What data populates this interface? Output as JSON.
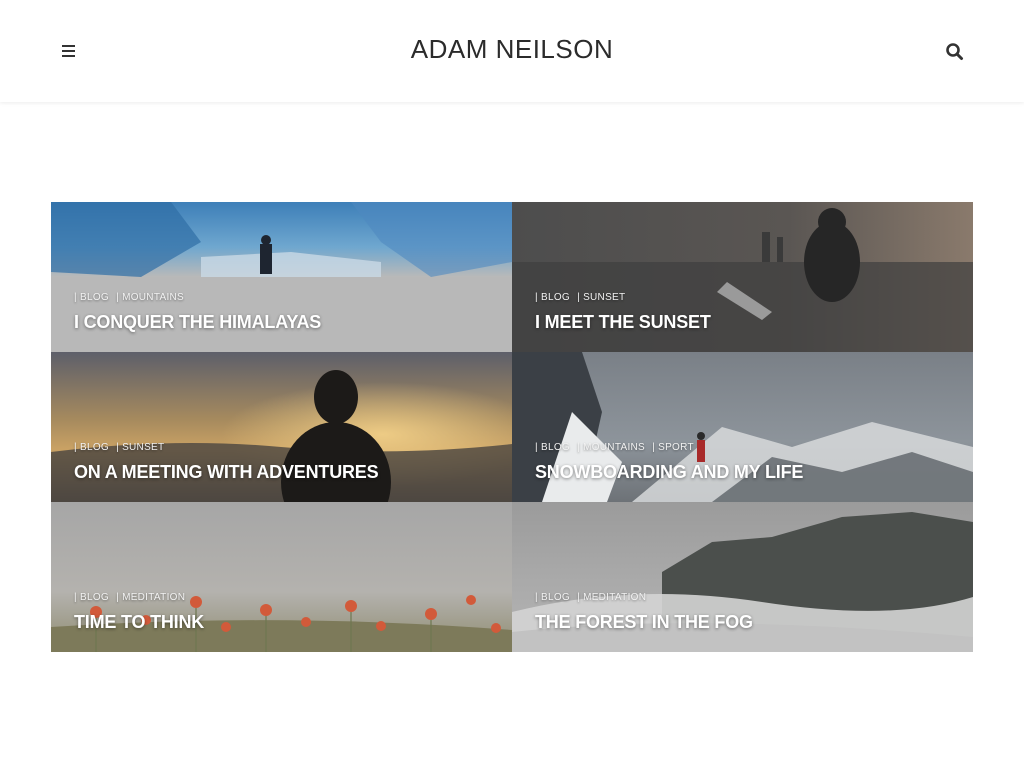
{
  "header": {
    "site_title": "ADAM NEILSON",
    "menu_icon": "hamburger-menu-icon",
    "search_icon": "search-icon"
  },
  "posts": [
    {
      "title": "I CONQUER THE HIMALAYAS",
      "categories": [
        "BLOG",
        "MOUNTAINS"
      ]
    },
    {
      "title": "I MEET THE SUNSET",
      "categories": [
        "BLOG",
        "SUNSET"
      ]
    },
    {
      "title": "ON A MEETING WITH ADVENTURES",
      "categories": [
        "BLOG",
        "SUNSET"
      ]
    },
    {
      "title": "SNOWBOARDING AND MY LIFE",
      "categories": [
        "BLOG",
        "MOUNTAINS",
        "SPORT"
      ]
    },
    {
      "title": "TIME TO THINK",
      "categories": [
        "BLOG",
        "MEDITATION"
      ]
    },
    {
      "title": "THE FOREST IN THE FOG",
      "categories": [
        "BLOG",
        "MEDITATION"
      ]
    }
  ]
}
